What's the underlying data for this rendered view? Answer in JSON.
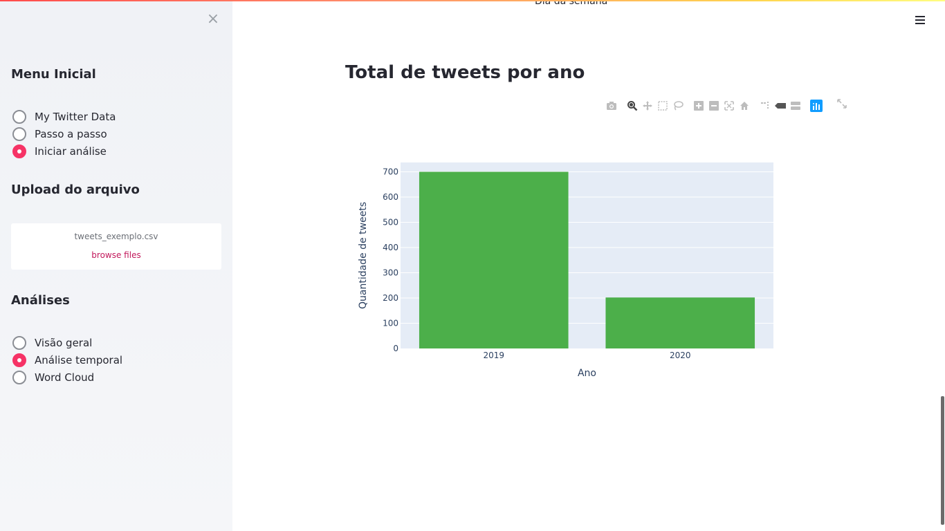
{
  "page": {
    "top_caption": "Dia da semana"
  },
  "sidebar": {
    "close_label": "×",
    "menu_heading": "Menu Inicial",
    "menu_options": [
      {
        "label": "My Twitter Data",
        "checked": false
      },
      {
        "label": "Passo a passo",
        "checked": false
      },
      {
        "label": "Iniciar análise",
        "checked": true
      }
    ],
    "upload_heading": "Upload do arquivo",
    "upload": {
      "file_name": "tweets_exemplo.csv",
      "browse_label": "browse files"
    },
    "analyses_heading": "Análises",
    "analyses_options": [
      {
        "label": "Visão geral",
        "checked": false
      },
      {
        "label": "Análise temporal",
        "checked": true
      },
      {
        "label": "Word Cloud",
        "checked": false
      }
    ]
  },
  "main": {
    "title": "Total de tweets por ano"
  },
  "toolbar": {
    "icons": [
      "camera-icon",
      "zoom-icon",
      "pan-icon",
      "box-select-icon",
      "lasso-select-icon",
      "zoom-in-icon",
      "zoom-out-icon",
      "autoscale-icon",
      "reset-axes-icon",
      "spike-lines-icon",
      "hover-closest-icon",
      "hover-compare-icon",
      "plotly-logo-icon",
      "fullscreen-icon"
    ]
  },
  "colors": {
    "accent": "#f63366",
    "bar": "#4caf4a",
    "plot_bg": "#e5ecf6",
    "plotly_blue": "#119dff"
  },
  "chart_data": {
    "type": "bar",
    "title": "Total de tweets por ano",
    "categories": [
      "2019",
      "2020"
    ],
    "values": [
      700,
      202
    ],
    "xlabel": "Ano",
    "ylabel": "Quantidade de tweets",
    "ylim": [
      0,
      737
    ],
    "yticks": [
      0,
      100,
      200,
      300,
      400,
      500,
      600,
      700
    ],
    "grid": true,
    "bar_color": "#4caf4a"
  }
}
